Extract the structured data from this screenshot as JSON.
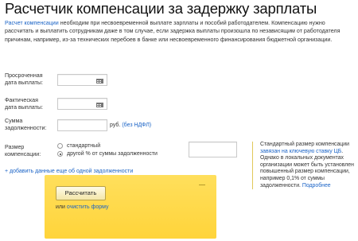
{
  "page": {
    "title": "Расчетчик компенсации за задержку зарплаты",
    "intro_link": "Расчет компенсации",
    "intro_text": " необходим при несвоевременной выплате зарплаты и пособий работодателем. Компенсацию нужно рассчитать и выплатить сотрудникам даже в том случае, если задержка выплаты произошла по независящим от работодателя причинам, например, из-за технических перебоев в банке или несвоевременного финансирования бюджетной организации."
  },
  "form": {
    "overdue_date": {
      "label_line1": "Просроченная",
      "label_line2": "дата выплаты:",
      "value": ""
    },
    "actual_date": {
      "label_line1": "Фактическая",
      "label_line2": "дата выплаты:",
      "value": ""
    },
    "debt": {
      "label_line1": "Сумма",
      "label_line2": "задолженности:",
      "value": "",
      "unit": "руб.",
      "ndfl_link": "(без НДФЛ)"
    },
    "compensation": {
      "label_line1": "Размер",
      "label_line2": "компенсации:",
      "option_standard": "стандартный",
      "option_other": "другой % от суммы задолженности",
      "selected": "option_other",
      "percent_value": ""
    },
    "add_data_link": "+ добавить данные еще об одной задолженности"
  },
  "note": {
    "text1": "Стандартный размер компенсации ",
    "link1": "завязан на ключевую ставку ЦБ",
    "text2": ". Однако в локальных документах организации может быть установлен повышенный размер компенсации, например 0,1% от суммы задолженности. ",
    "link2": "Подробнее"
  },
  "action": {
    "calculate_label": "Рассчитать",
    "or_text": "или ",
    "clear_link": "очистить форму"
  },
  "colors": {
    "link": "#1a63c6",
    "panel": "#ffd84a"
  },
  "icons": {
    "date_picker": "calendar-icon"
  }
}
